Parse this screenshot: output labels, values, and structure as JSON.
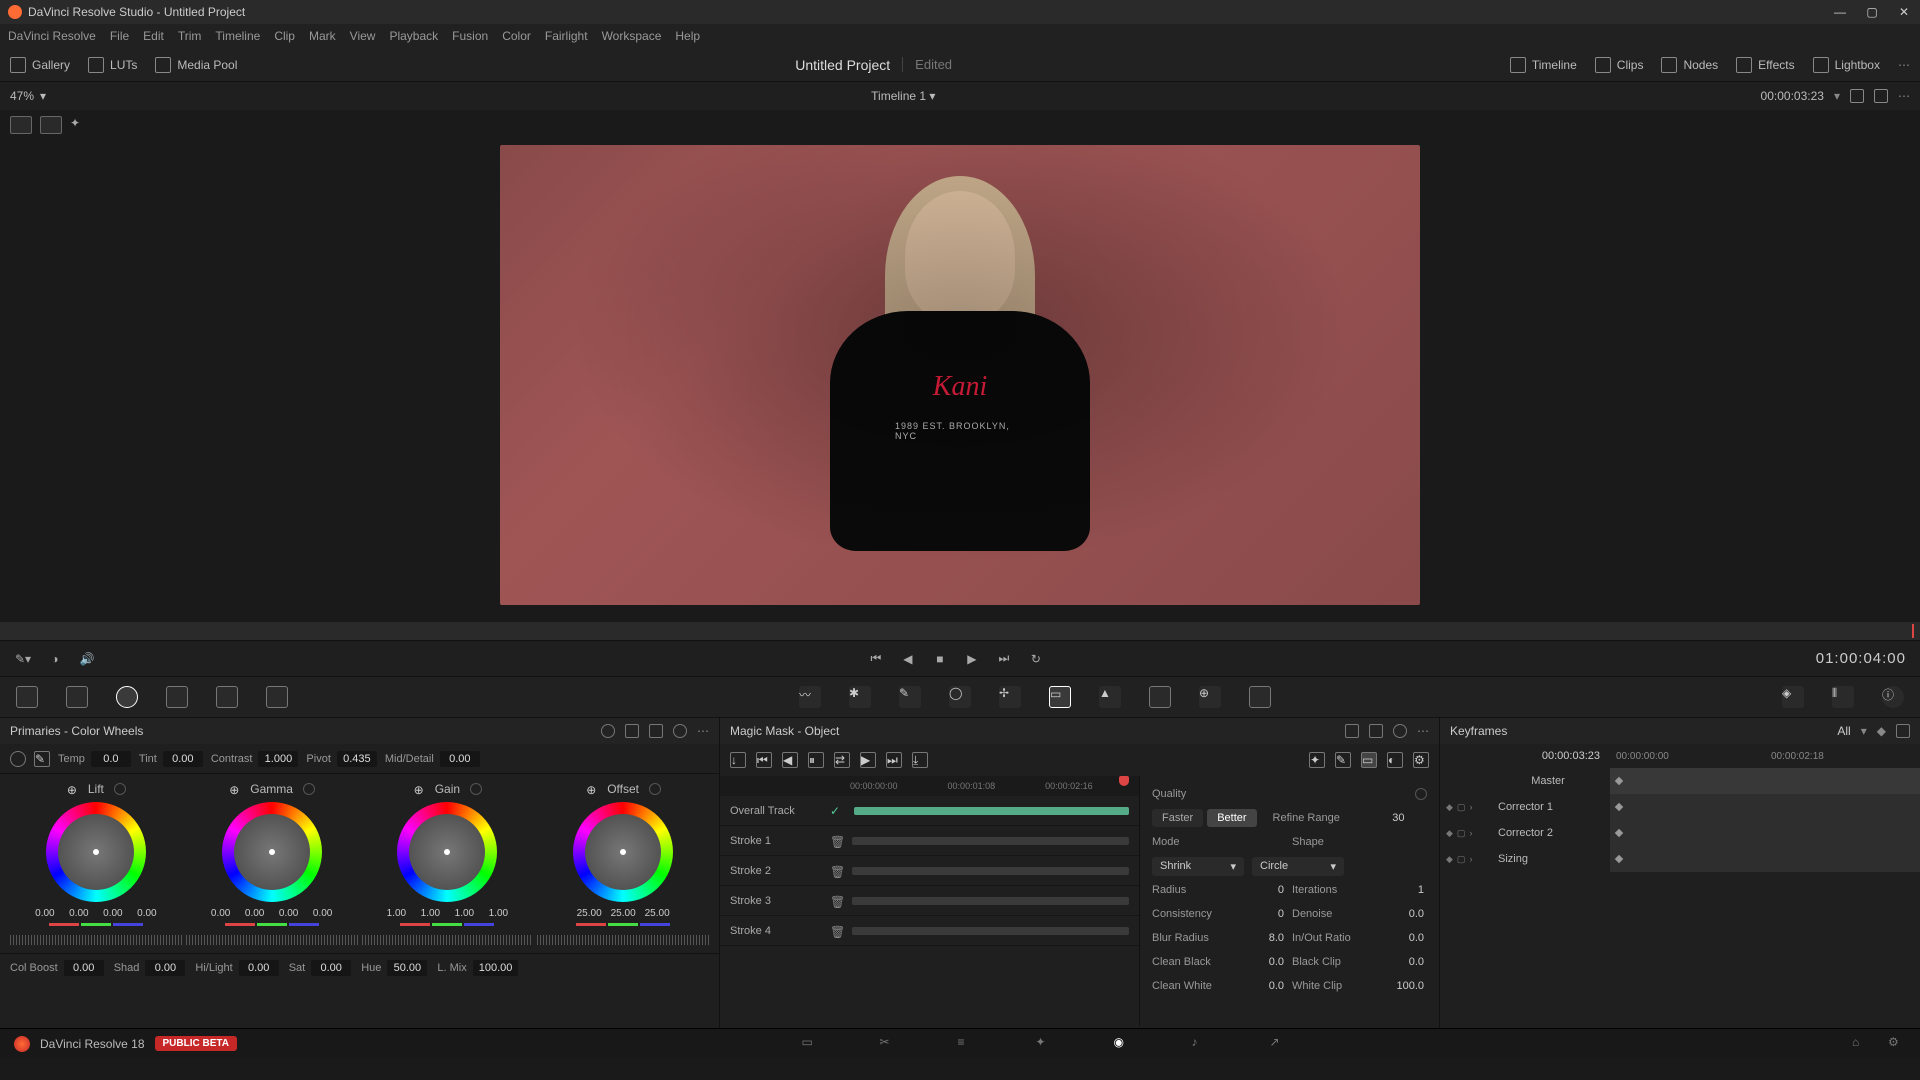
{
  "titlebar": {
    "text": "DaVinci Resolve Studio - Untitled Project"
  },
  "menu": [
    "DaVinci Resolve",
    "File",
    "Edit",
    "Trim",
    "Timeline",
    "Clip",
    "Mark",
    "View",
    "Playback",
    "Fusion",
    "Color",
    "Fairlight",
    "Workspace",
    "Help"
  ],
  "toptool": {
    "left": [
      "Gallery",
      "LUTs",
      "Media Pool"
    ],
    "project": "Untitled Project",
    "status": "Edited",
    "right": [
      "Timeline",
      "Clips",
      "Nodes",
      "Effects",
      "Lightbox"
    ]
  },
  "viewer": {
    "zoom": "47%",
    "timeline_name": "Timeline 1",
    "tc": "00:00:03:23",
    "shirt_logo": "Kani",
    "shirt_text": "1989 EST. BROOKLYN, NYC"
  },
  "transport": {
    "duration": "01:00:04:00"
  },
  "primaries": {
    "title": "Primaries - Color Wheels",
    "top_adjust": [
      {
        "label": "Temp",
        "val": "0.0"
      },
      {
        "label": "Tint",
        "val": "0.00"
      },
      {
        "label": "Contrast",
        "val": "1.000"
      },
      {
        "label": "Pivot",
        "val": "0.435"
      },
      {
        "label": "Mid/Detail",
        "val": "0.00"
      }
    ],
    "wheels": [
      {
        "name": "Lift",
        "vals": [
          "0.00",
          "0.00",
          "0.00",
          "0.00"
        ]
      },
      {
        "name": "Gamma",
        "vals": [
          "0.00",
          "0.00",
          "0.00",
          "0.00"
        ]
      },
      {
        "name": "Gain",
        "vals": [
          "1.00",
          "1.00",
          "1.00",
          "1.00"
        ]
      },
      {
        "name": "Offset",
        "vals": [
          "25.00",
          "25.00",
          "25.00"
        ]
      }
    ],
    "bottom_adjust": [
      {
        "label": "Col Boost",
        "val": "0.00"
      },
      {
        "label": "Shad",
        "val": "0.00"
      },
      {
        "label": "Hi/Light",
        "val": "0.00"
      },
      {
        "label": "Sat",
        "val": "0.00"
      },
      {
        "label": "Hue",
        "val": "50.00"
      },
      {
        "label": "L. Mix",
        "val": "100.00"
      }
    ]
  },
  "magicmask": {
    "title": "Magic Mask - Object",
    "ruler": [
      "00:00:00:00",
      "00:00:01:08",
      "00:00:02:16"
    ],
    "strokes": [
      {
        "name": "Overall Track",
        "check": true
      },
      {
        "name": "Stroke 1"
      },
      {
        "name": "Stroke 2"
      },
      {
        "name": "Stroke 3"
      },
      {
        "name": "Stroke 4"
      }
    ],
    "quality_label": "Quality",
    "faster": "Faster",
    "better": "Better",
    "refine_label": "Refine Range",
    "refine_val": "30",
    "mode_label": "Mode",
    "mode_val": "Shrink",
    "shape_label": "Shape",
    "shape_val": "Circle",
    "params": [
      {
        "l1": "Radius",
        "v1": "0",
        "l2": "Iterations",
        "v2": "1"
      },
      {
        "l1": "Consistency",
        "v1": "0",
        "l2": "Denoise",
        "v2": "0.0"
      },
      {
        "l1": "Blur Radius",
        "v1": "8.0",
        "l2": "In/Out Ratio",
        "v2": "0.0"
      },
      {
        "l1": "Clean Black",
        "v1": "0.0",
        "l2": "Black Clip",
        "v2": "0.0"
      },
      {
        "l1": "Clean White",
        "v1": "0.0",
        "l2": "White Clip",
        "v2": "100.0"
      }
    ]
  },
  "keyframes": {
    "title": "Keyframes",
    "filter": "All",
    "tc": "00:00:03:23",
    "ruler": [
      "00:00:00:00",
      "00:00:02:18"
    ],
    "master": "Master",
    "rows": [
      "Corrector 1",
      "Corrector 2",
      "Sizing"
    ]
  },
  "footer": {
    "version": "DaVinci Resolve 18",
    "badge": "PUBLIC BETA"
  }
}
